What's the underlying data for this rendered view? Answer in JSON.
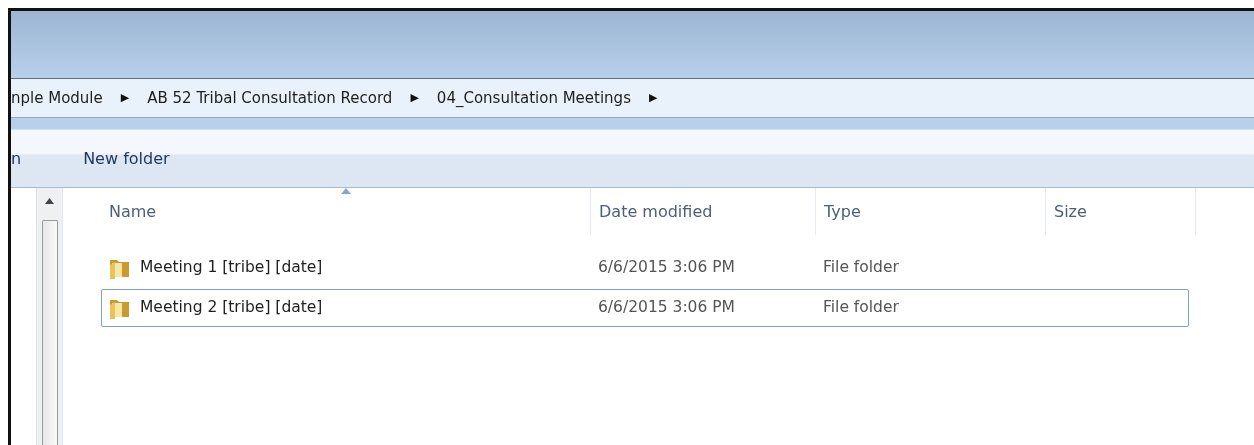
{
  "breadcrumb": [
    {
      "label": "nple Module"
    },
    {
      "label": "AB 52 Tribal Consultation Record"
    },
    {
      "label": "04_Consultation Meetings"
    }
  ],
  "breadcrumb_separator": "▶",
  "toolbar": [
    {
      "label": "n"
    },
    {
      "label": "New folder"
    }
  ],
  "table": {
    "columns": [
      {
        "label": "Name",
        "sorted": true
      },
      {
        "label": "Date modified",
        "sorted": false
      },
      {
        "label": "Type",
        "sorted": false
      },
      {
        "label": "Size",
        "sorted": false
      }
    ],
    "rows": [
      {
        "name": "Meeting 1 [tribe] [date]",
        "date_modified": "6/6/2015 3:06 PM",
        "type": "File folder",
        "selected": false
      },
      {
        "name": "Meeting 2 [tribe] [date]",
        "date_modified": "6/6/2015 3:06 PM",
        "type": "File folder",
        "selected": true
      }
    ]
  }
}
